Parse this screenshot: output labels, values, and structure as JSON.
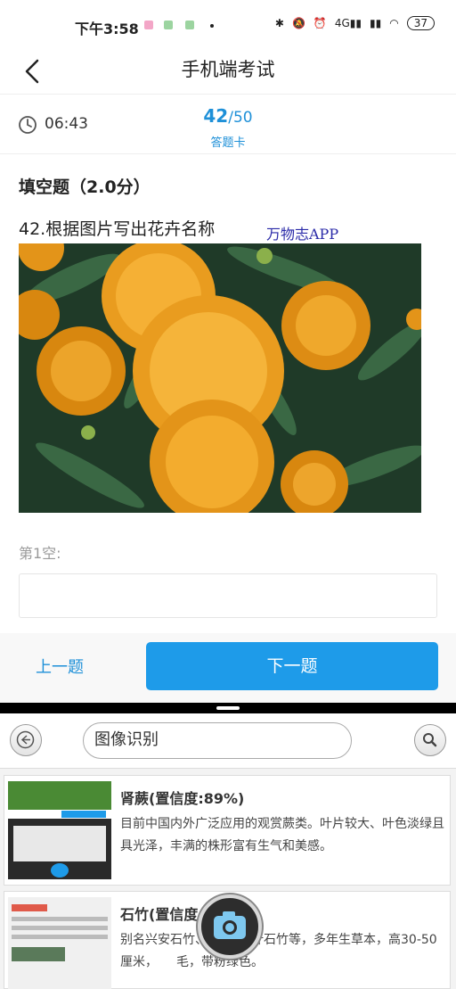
{
  "status_bar": {
    "time": "下午3:58",
    "network": "4G",
    "battery": "37"
  },
  "header": {
    "title": "手机端考试"
  },
  "exam": {
    "timer": "06:43",
    "current": "42",
    "total": "50",
    "answer_card_label": "答题卡"
  },
  "question": {
    "type": "填空题（2.0分）",
    "text": "42.根据图片写出花卉名称",
    "watermark": "万物志APP",
    "image_alt": "marigold-flowers-photo",
    "blank_label": "第1空:",
    "blank_value": ""
  },
  "nav": {
    "prev_label": "上一题",
    "next_label": "下一题"
  },
  "recognizer": {
    "search_text": "图像识别",
    "results": [
      {
        "name": "肾蕨(置信度:89%)",
        "desc": "目前中国内外广泛应用的观赏蕨类。叶片较大、叶色淡绿且具光泽，丰满的株形富有生气和美感。"
      },
      {
        "name": "石竹(置信度",
        "desc": "别名兴安石竹、　　　钻叶石竹等，多年生草本，高30-50厘米，　　毛，带粉绿色。"
      }
    ]
  },
  "colors": {
    "accent": "#1e9be9",
    "flower": "#f0a020",
    "leaf": "#2f5a3a"
  }
}
